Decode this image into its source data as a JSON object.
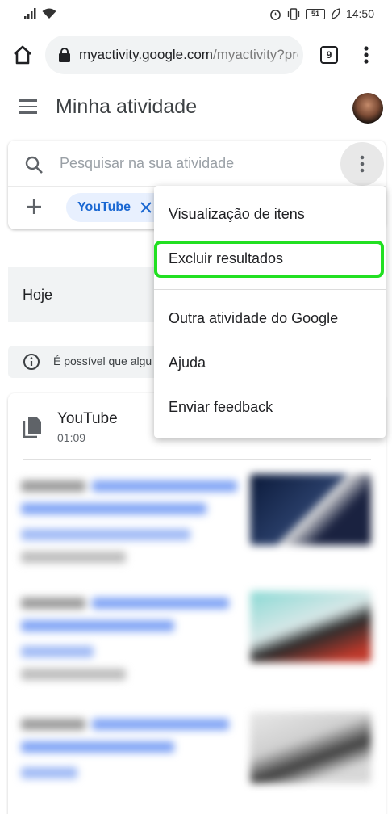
{
  "status_bar": {
    "time": "14:50",
    "battery": "51"
  },
  "browser": {
    "url_host": "myactivity.google.com",
    "url_path": "/myactivity?pro",
    "tab_count": "9"
  },
  "app": {
    "title": "Minha atividade"
  },
  "search": {
    "placeholder": "Pesquisar na sua atividade",
    "filter_chip": "YouTube"
  },
  "today": {
    "label": "Hoje",
    "info_text": "É possível que algu"
  },
  "activity_card": {
    "title": "YouTube",
    "time": "01:09"
  },
  "menu": {
    "items": [
      "Visualização de itens",
      "Excluir resultados",
      "Outra atividade do Google",
      "Ajuda",
      "Enviar feedback"
    ],
    "highlight_color": "#22e022"
  },
  "colors": {
    "chip_bg": "#e8f0fe",
    "chip_text": "#1967d2",
    "highlight": "#22e022"
  }
}
